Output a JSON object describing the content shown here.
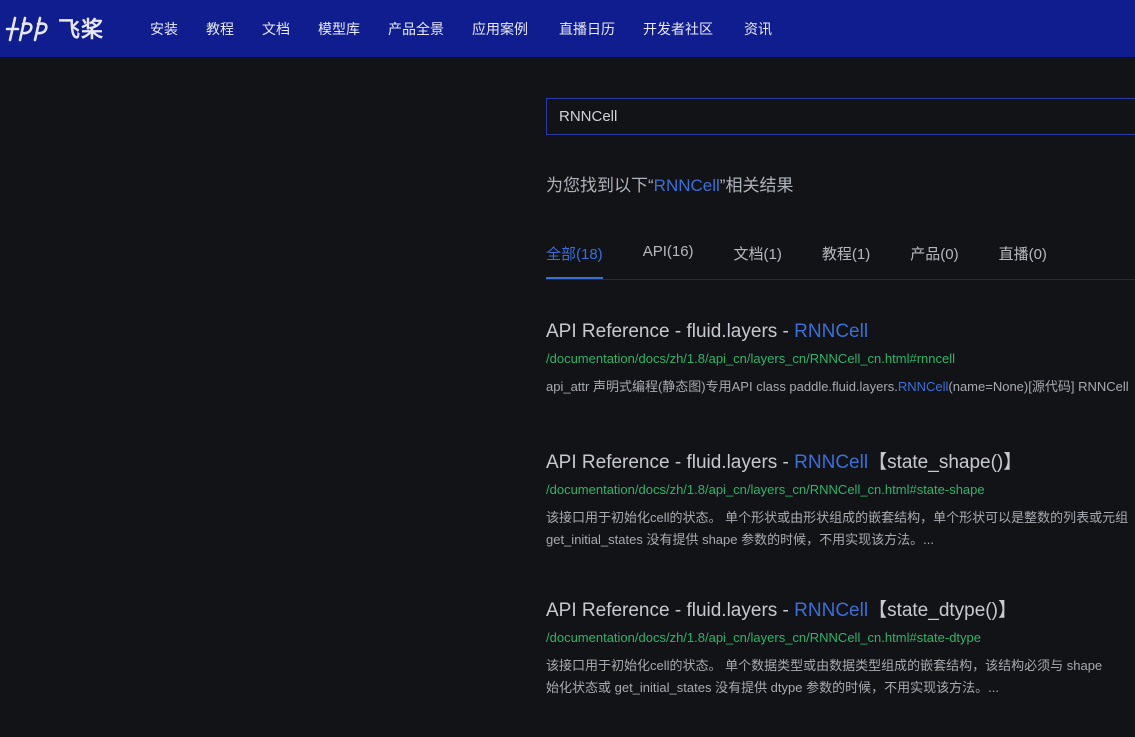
{
  "brand": {
    "logo_text": "飞桨",
    "logo_icon": "paddle-logo-icon",
    "accent": "#0f1d8f"
  },
  "nav": {
    "items": [
      "安装",
      "教程",
      "文档",
      "模型库",
      "产品全景",
      "应用案例",
      "直播日历",
      "开发者社区",
      "资讯"
    ]
  },
  "search": {
    "value": "RNNCell"
  },
  "summary": {
    "prefix": "为您找到以下“",
    "query": "RNNCell",
    "suffix": "”相关结果"
  },
  "tabs": [
    {
      "label": "全部(18)",
      "active": true
    },
    {
      "label": "API(16)",
      "active": false
    },
    {
      "label": "文档(1)",
      "active": false
    },
    {
      "label": "教程(1)",
      "active": false
    },
    {
      "label": "产品(0)",
      "active": false
    },
    {
      "label": "直播(0)",
      "active": false
    }
  ],
  "results": [
    {
      "title_prefix": "API Reference - fluid.layers - ",
      "title_hl": "RNNCell",
      "title_suffix": "",
      "url": "/documentation/docs/zh/1.8/api_cn/layers_cn/RNNCell_cn.html#rnncell",
      "snippet_lines": [
        {
          "pre": "api_attr 声明式编程(静态图)专用API class paddle.fluid.layers.",
          "hl": "RNNCell",
          "post": "(name=None)[源代码] RNNCell"
        }
      ]
    },
    {
      "title_prefix": "API Reference - fluid.layers - ",
      "title_hl": "RNNCell",
      "title_suffix": "【state_shape()】",
      "url": "/documentation/docs/zh/1.8/api_cn/layers_cn/RNNCell_cn.html#state-shape",
      "snippet_lines": [
        {
          "pre": "该接口用于初始化cell的状态。 单个形状或由形状组成的嵌套结构，单个形状可以是整数的列表或元组",
          "hl": "",
          "post": ""
        },
        {
          "pre": "get_initial_states 没有提供 shape 参数的时候，不用实现该方法。...",
          "hl": "",
          "post": ""
        }
      ]
    },
    {
      "title_prefix": "API Reference - fluid.layers - ",
      "title_hl": "RNNCell",
      "title_suffix": "【state_dtype()】",
      "url": "/documentation/docs/zh/1.8/api_cn/layers_cn/RNNCell_cn.html#state-dtype",
      "snippet_lines": [
        {
          "pre": "该接口用于初始化cell的状态。 单个数据类型或由数据类型组成的嵌套结构，该结构必须与 shape",
          "hl": "",
          "post": ""
        },
        {
          "pre": "始化状态或 get_initial_states 没有提供 dtype 参数的时候，不用实现该方法。...",
          "hl": "",
          "post": ""
        }
      ]
    }
  ]
}
